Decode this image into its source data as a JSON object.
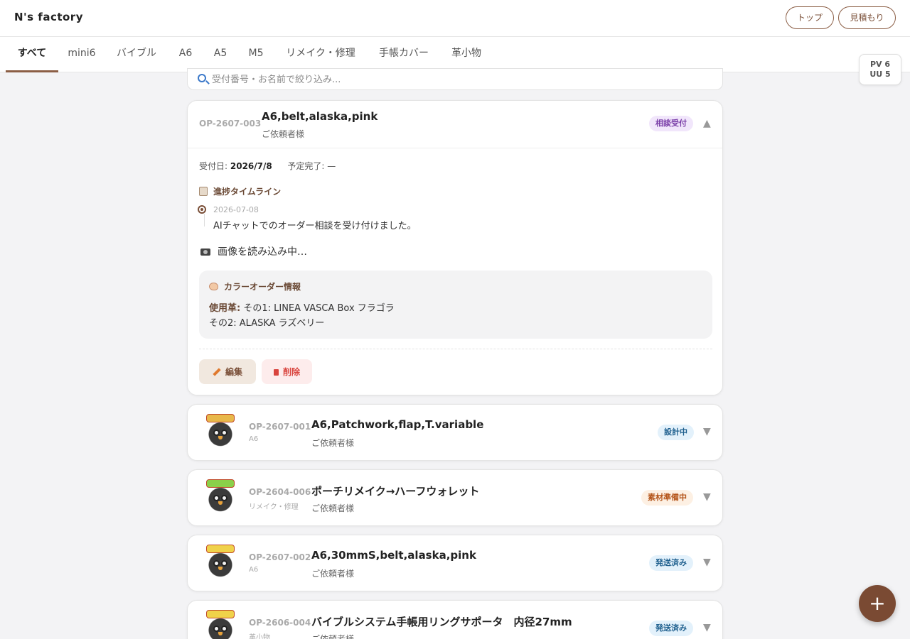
{
  "header": {
    "brand": "N's factory",
    "top_button": "トップ",
    "quote_button": "見積もり"
  },
  "tabs": [
    {
      "label": "すべて",
      "active": true
    },
    {
      "label": "mini6"
    },
    {
      "label": "バイブル"
    },
    {
      "label": "A6"
    },
    {
      "label": "A5"
    },
    {
      "label": "M5"
    },
    {
      "label": "リメイク・修理"
    },
    {
      "label": "手帳カバー"
    },
    {
      "label": "革小物"
    }
  ],
  "stats": {
    "pv": "PV 6",
    "uu": "UU 5"
  },
  "search": {
    "placeholder": "受付番号・お名前で絞り込み..."
  },
  "expanded_order": {
    "id": "OP-2607-003",
    "title": "A6,belt,alaska,pink",
    "client": "ご依頼者様",
    "status": "相談受付",
    "received_label": "受付日:",
    "received_date": "2026/7/8",
    "due_label": "予定完了:",
    "due_value": "—",
    "timeline_title": "進捗タイムライン",
    "timeline": [
      {
        "date": "2026-07-08",
        "text": "AIチャットでのオーダー相談を受け付けました。"
      }
    ],
    "image_loading": "画像を読み込み中…",
    "color_title": "カラーオーダー情報",
    "leather_label": "使用革:",
    "leather_1": "その1: LINEA VASCA Box フラゴラ",
    "leather_2": "その2: ALASKA ラズベリー",
    "edit_label": "編集",
    "delete_label": "削除"
  },
  "orders": [
    {
      "id": "OP-2607-001",
      "category": "A6",
      "title": "A6,Patchwork,flap,T.variable",
      "client": "ご依頼者様",
      "status": "設計中",
      "badge_bg": "#e3f1fb",
      "badge_fg": "#1e5f8e"
    },
    {
      "id": "OP-2604-006",
      "category": "リメイク・修理",
      "title": "ポーチリメイク→ハーフウォレット",
      "client": "ご依頼者様",
      "status": "素材準備中",
      "badge_bg": "#fdf0e3",
      "badge_fg": "#b5561c"
    },
    {
      "id": "OP-2607-002",
      "category": "A6",
      "title": "A6,30mmS,belt,alaska,pink",
      "client": "ご依頼者様",
      "status": "発送済み",
      "badge_bg": "#e3f1fb",
      "badge_fg": "#1e5f8e"
    },
    {
      "id": "OP-2606-004",
      "category": "革小物",
      "title": "バイブルシステム手帳用リングサポータ　内径27mm",
      "client": "ご依頼者様",
      "status": "発送済み",
      "badge_bg": "#e3f1fb",
      "badge_fg": "#1e5f8e"
    }
  ],
  "colors": {
    "accent": "#8b5e45",
    "fab": "#7a4a33",
    "consult_badge_bg": "#f1e6fb",
    "consult_badge_fg": "#7a3ea8"
  },
  "fab_label": "+"
}
